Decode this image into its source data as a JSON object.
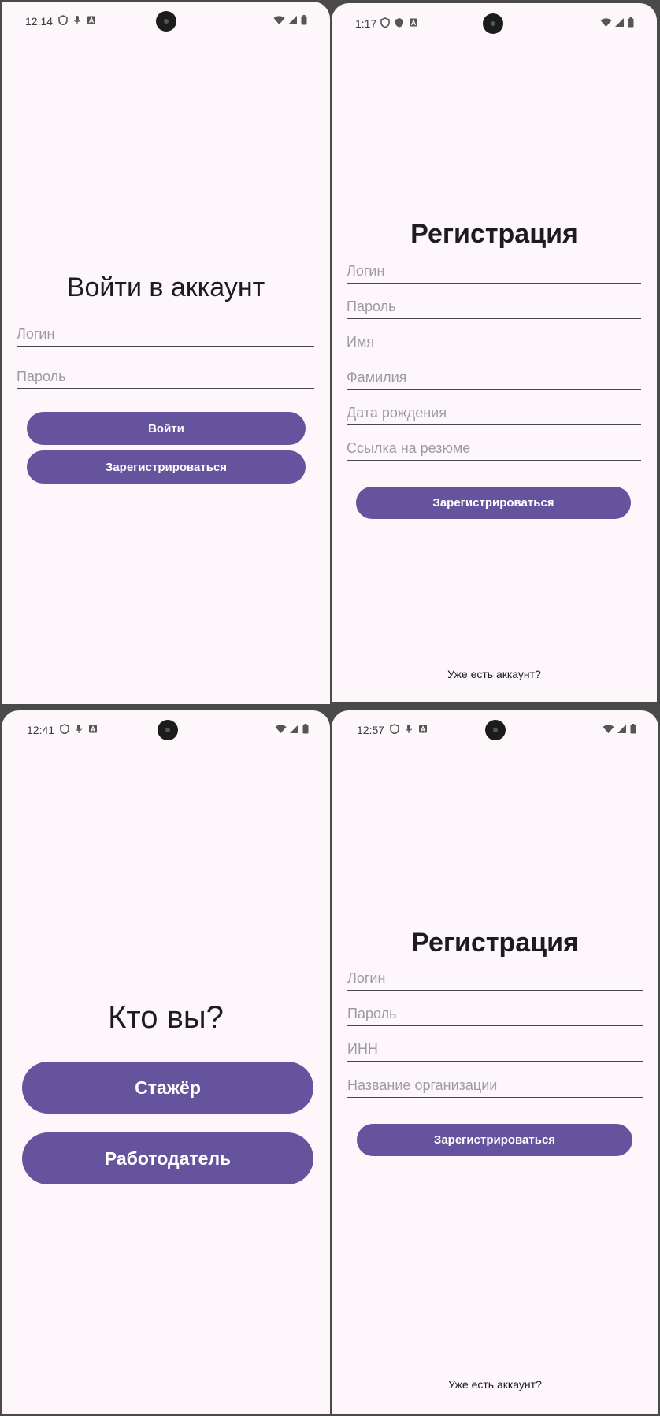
{
  "screens": {
    "login": {
      "status": {
        "time": "12:14"
      },
      "title": "Войти в аккаунт",
      "login_placeholder": "Логин",
      "password_placeholder": "Пароль",
      "login_button": "Войти",
      "register_button": "Зарегистрироваться"
    },
    "intern_register": {
      "status": {
        "time": "1:17"
      },
      "title": "Регистрация",
      "fields": [
        "Логин",
        "Пароль",
        "Имя",
        "Фамилия",
        "Дата рождения",
        "Ссылка на резюме"
      ],
      "register_button": "Зарегистрироваться",
      "have_account_link": "Уже есть аккаунт?"
    },
    "role_select": {
      "status": {
        "time": "12:41"
      },
      "title": "Кто вы?",
      "intern_button": "Стажёр",
      "employer_button": "Работодатель"
    },
    "employer_register": {
      "status": {
        "time": "12:57"
      },
      "title": "Регистрация",
      "fields": [
        "Логин",
        "Пароль",
        "ИНН",
        "Название организации"
      ],
      "register_button": "Зарегистрироваться",
      "have_account_link": "Уже есть аккаунт?"
    }
  },
  "colors": {
    "background": "#fdf7fc",
    "accent": "#65539d",
    "text": "#1d1b20",
    "placeholder": "#9e9aa2"
  },
  "icons": {
    "status_left": [
      "shield-icon",
      "mic-icon",
      "font-icon"
    ],
    "status_right": [
      "wifi-icon",
      "signal-icon",
      "battery-icon"
    ]
  }
}
